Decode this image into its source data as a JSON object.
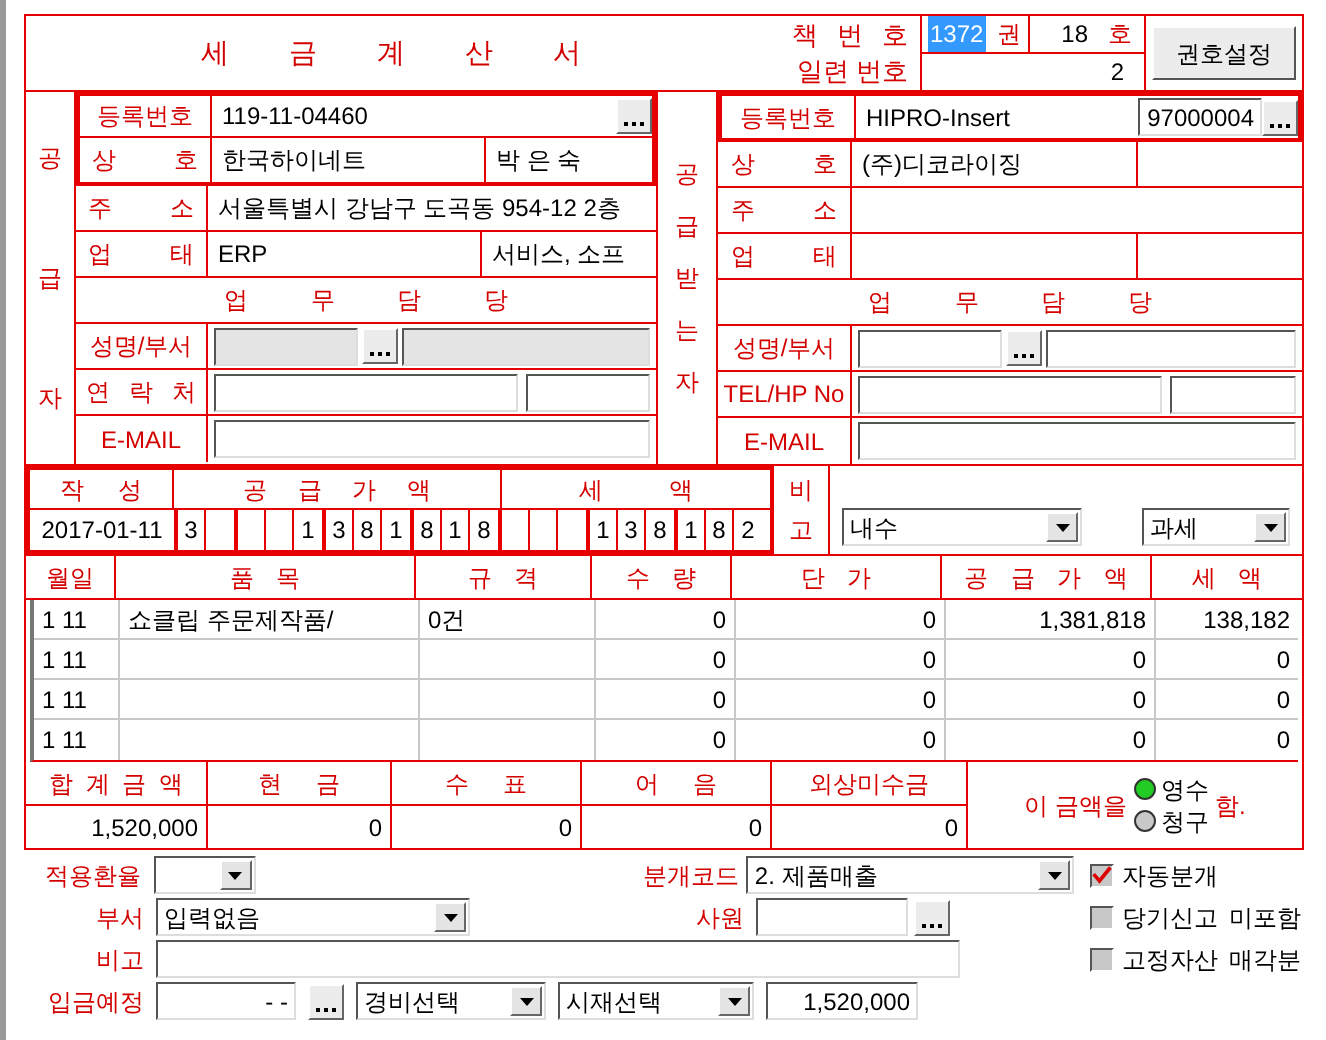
{
  "header": {
    "title": "세 금 계 산 서",
    "book_label": "책 번 호",
    "serial_label": "일련 번호",
    "volume": "1372",
    "volume_unit": "권",
    "issue": "18",
    "issue_unit": "호",
    "serial": "2",
    "settings_button": "권호설정"
  },
  "supplier": {
    "side_label": "공급자",
    "reg_label": "등록번호",
    "reg_no": "119-11-04460",
    "name_label": "상 호",
    "name": "한국하이네트",
    "name_extra": "박 은 숙",
    "addr_label": "주 소",
    "addr": "서울특별시 강남구 도곡동 954-12 2층",
    "biz_label": "업 태",
    "biz_type": "ERP",
    "biz_item": "서비스, 소프",
    "staff_label": "업 무 담 당",
    "person_label": "성명/부서",
    "contact_label": "연 락 처",
    "email_label": "E-MAIL",
    "person_disabled": true
  },
  "recipient": {
    "side_label": "공급받는자",
    "reg_label": "등록번호",
    "reg_no": "HIPRO-Insert",
    "code": "97000004",
    "name_label": "상 호",
    "name": "(주)디코라이징",
    "addr_label": "주 소",
    "biz_label": "업 태",
    "staff_label": "업 무 담 당",
    "person_label": "성명/부서",
    "contact_label": "TEL/HP No",
    "email_label": "E-MAIL",
    "person_disabled": false
  },
  "amount": {
    "written_label": "작 성",
    "supply_label": "공 급 가 액",
    "tax_label": "세 액",
    "date": "2017-01-11",
    "blank_count": "3",
    "supply_digits": [
      "1",
      "3",
      "8",
      "1",
      "8",
      "1",
      "8"
    ],
    "tax_digits": [
      "1",
      "3",
      "8",
      "1",
      "8",
      "2"
    ],
    "remark_label": "비고",
    "trade_select": "내수",
    "tax_select": "과세"
  },
  "items": {
    "columns": [
      "월일",
      "품 목",
      "규 격",
      "수 량",
      "단 가",
      "공 급 가 액",
      "세 액"
    ],
    "rows": [
      {
        "date": "1 11",
        "item": "쇼클립 주문제작품/",
        "spec": "0건",
        "qty": "0",
        "price": "0",
        "supply": "1,381,818",
        "tax": "138,182"
      },
      {
        "date": "1 11",
        "qty": "0",
        "price": "0",
        "supply": "0",
        "tax": "0"
      },
      {
        "date": "1 11",
        "qty": "0",
        "price": "0",
        "supply": "0",
        "tax": "0"
      },
      {
        "date": "1 11",
        "qty": "0",
        "price": "0",
        "supply": "0",
        "tax": "0"
      }
    ]
  },
  "totals": {
    "columns": [
      {
        "label": "합 계 금 액",
        "value": "1,520,000"
      },
      {
        "label": "현 금",
        "value": "0"
      },
      {
        "label": "수 표",
        "value": "0"
      },
      {
        "label": "어 음",
        "value": "0"
      },
      {
        "label": "외상미수금",
        "value": "0"
      }
    ],
    "receipt": {
      "prefix": "이 금액을",
      "options": [
        {
          "label": "영수",
          "selected": true
        },
        {
          "label": "청구",
          "selected": false
        }
      ],
      "suffix": "함."
    }
  },
  "bottom": {
    "exchange_label": "적용환율",
    "journal_label": "분개코드",
    "journal_select": "2. 제품매출",
    "dept_label": "부서",
    "dept_select": "입력없음",
    "employee_label": "사원",
    "remark_label": "비고",
    "deposit_label": "입금예정",
    "deposit_date": "- -",
    "expense_select": "경비선택",
    "cash_select": "시재선택",
    "deposit_amount": "1,520,000",
    "checks": [
      {
        "label": "자동분개",
        "checked": true
      },
      {
        "label": "당기신고 미포함",
        "checked": false
      },
      {
        "label": "고정자산 매각분",
        "checked": false
      }
    ]
  }
}
